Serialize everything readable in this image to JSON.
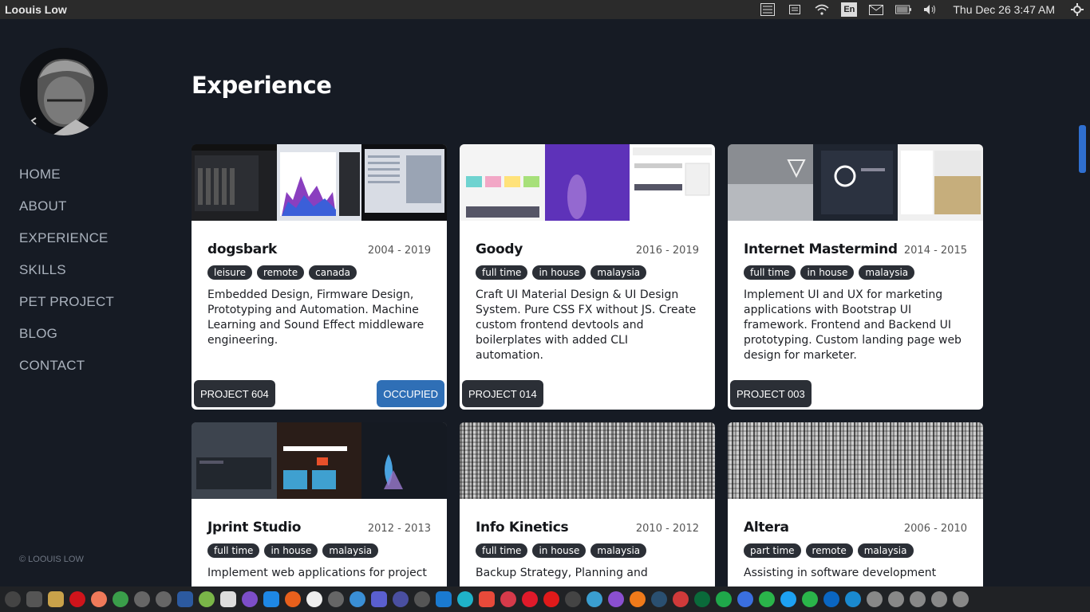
{
  "topbar": {
    "app_title": "Loouis Low",
    "lang": "En",
    "clock": "Thu Dec 26  3:47 AM",
    "tray_icons": [
      "list-icon",
      "keyboard-icon",
      "wifi-icon",
      "lang-icon",
      "mail-icon",
      "battery-icon",
      "volume-icon",
      "power-icon"
    ]
  },
  "sidebar": {
    "nav": [
      "HOME",
      "ABOUT",
      "EXPERIENCE",
      "SKILLS",
      "PET PROJECT",
      "BLOG",
      "CONTACT"
    ],
    "copyright": "© LOOUIS LOW"
  },
  "main": {
    "title": "Experience",
    "cards": [
      {
        "name": "dogsbark",
        "years": "2004 - 2019",
        "tags": [
          "leisure",
          "remote",
          "canada"
        ],
        "desc": "Embedded Design, Firmware Design, Prototyping and Automation. Machine Learning and Sound Effect middleware engineering.",
        "project": "PROJECT 604",
        "status": "OCCUPIED"
      },
      {
        "name": "Goody",
        "years": "2016 - 2019",
        "tags": [
          "full time",
          "in house",
          "malaysia"
        ],
        "desc": "Craft UI Material Design & UI Design System. Pure CSS FX without JS. Create custom frontend devtools and boilerplates with added CLI automation.",
        "project": "PROJECT 014"
      },
      {
        "name": "Internet Mastermind",
        "years": "2014 - 2015",
        "tags": [
          "full time",
          "in house",
          "malaysia"
        ],
        "desc": "Implement UI and UX for marketing applications with Bootstrap UI framework. Frontend and Backend UI prototyping. Custom landing page web design for marketer.",
        "project": "PROJECT 003"
      },
      {
        "name": "Jprint Studio",
        "years": "2012 - 2013",
        "tags": [
          "full time",
          "in house",
          "malaysia"
        ],
        "desc": "Implement web applications for project"
      },
      {
        "name": "Info Kinetics",
        "years": "2010 - 2012",
        "tags": [
          "full time",
          "in house",
          "malaysia"
        ],
        "desc": "Backup Strategy, Planning and"
      },
      {
        "name": "Altera",
        "years": "2006 - 2010",
        "tags": [
          "part time",
          "remote",
          "malaysia"
        ],
        "desc": "Assisting in software development"
      }
    ]
  },
  "colors": {
    "background": "#161b24",
    "card": "#ffffff",
    "tag": "#2b2f36",
    "occupied": "#2f6fb6",
    "scrollbar": "#2f6fd0"
  }
}
